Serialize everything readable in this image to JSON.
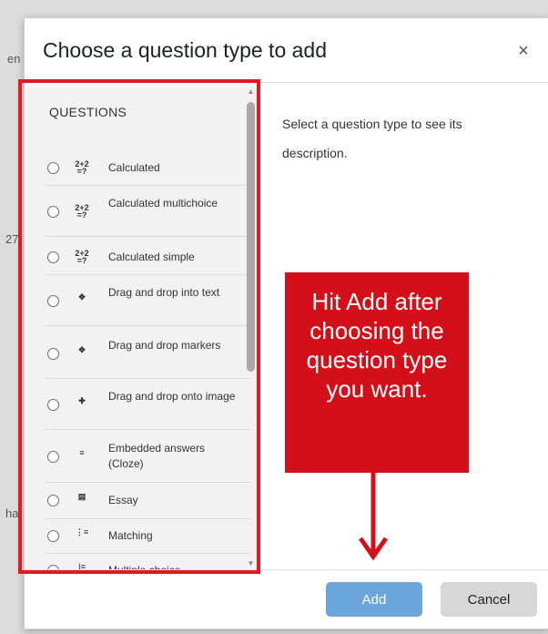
{
  "modal": {
    "title": "Choose a question type to add",
    "close_glyph": "×",
    "section_title": "QUESTIONS",
    "description": "Select a question type to see its description.",
    "options": [
      {
        "label": "Calculated",
        "icon": "calculated-icon",
        "glyph": "2+2\n=?"
      },
      {
        "label": "Calculated multichoice",
        "icon": "calculated-multichoice-icon",
        "glyph": "2+2\n=?"
      },
      {
        "label": "Calculated simple",
        "icon": "calculated-simple-icon",
        "glyph": "2+2\n=?"
      },
      {
        "label": "Drag and drop into text",
        "icon": "drag-drop-text-icon",
        "glyph": "✥"
      },
      {
        "label": "Drag and drop markers",
        "icon": "drag-drop-markers-icon",
        "glyph": "✥"
      },
      {
        "label": "Drag and drop onto image",
        "icon": "drag-drop-image-icon",
        "glyph": "✚"
      },
      {
        "label": "Embedded answers (Cloze)",
        "icon": "cloze-icon",
        "glyph": "≡"
      },
      {
        "label": "Essay",
        "icon": "essay-icon",
        "glyph": "▤"
      },
      {
        "label": "Matching",
        "icon": "matching-icon",
        "glyph": "⋮≡"
      },
      {
        "label": "Multiple choice",
        "icon": "multiple-choice-icon",
        "glyph": "⁝≡"
      }
    ],
    "add_label": "Add",
    "cancel_label": "Cancel"
  },
  "callout": {
    "text": "Hit Add after choosing the question type you want."
  },
  "background": {
    "fragments": [
      "en",
      "27",
      "ha"
    ]
  },
  "colors": {
    "annotation_red": "#e01a22",
    "callout_red": "#d3101a",
    "add_button": "#6aa6db",
    "cancel_button": "#d7d7d7"
  }
}
